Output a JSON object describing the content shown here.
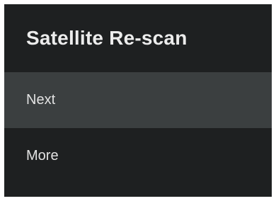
{
  "dialog": {
    "title": "Satellite Re-scan",
    "items": [
      {
        "label": "Next",
        "focused": true
      },
      {
        "label": "More",
        "focused": false
      }
    ]
  },
  "colors": {
    "panel_background": "#1e2021",
    "focused_item_background": "#3b3f40",
    "text": "#e2e2e2"
  }
}
